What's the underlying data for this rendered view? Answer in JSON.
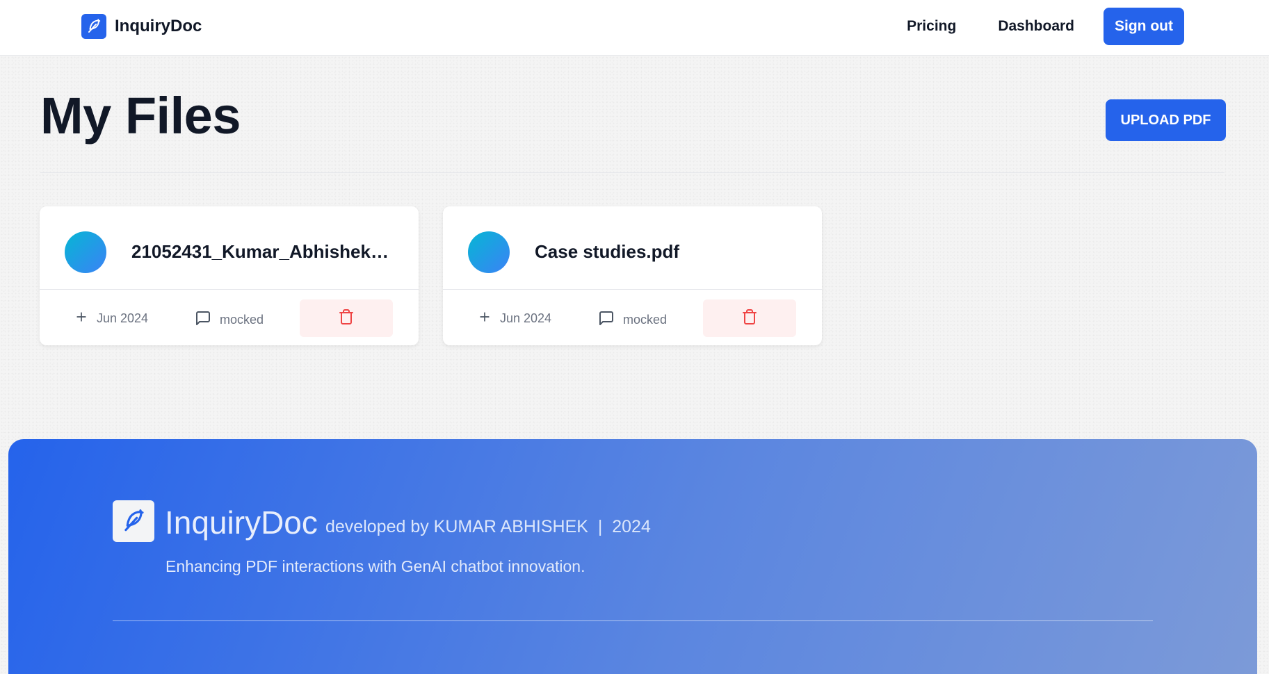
{
  "navbar": {
    "brand": "InquiryDoc",
    "links": [
      {
        "label": "Pricing"
      },
      {
        "label": "Dashboard"
      }
    ],
    "signout_label": "Sign out",
    "accent_color": "#2563eb"
  },
  "header": {
    "title": "My Files",
    "upload_label": "UPLOAD PDF"
  },
  "files": [
    {
      "name": "21052431_Kumar_Abhishek_...",
      "date": "Jun 2024",
      "messages": "mocked"
    },
    {
      "name": "Case studies.pdf",
      "date": "Jun 2024",
      "messages": "mocked"
    }
  ],
  "footer": {
    "brand": "InquiryDoc",
    "credit": "developed by KUMAR ABHISHEK  |  2024",
    "tagline": "Enhancing PDF interactions with GenAI chatbot innovation."
  },
  "icons": {
    "logo": "feather-icon",
    "date": "plus-icon",
    "messages": "message-square-icon",
    "delete": "trash-icon"
  }
}
